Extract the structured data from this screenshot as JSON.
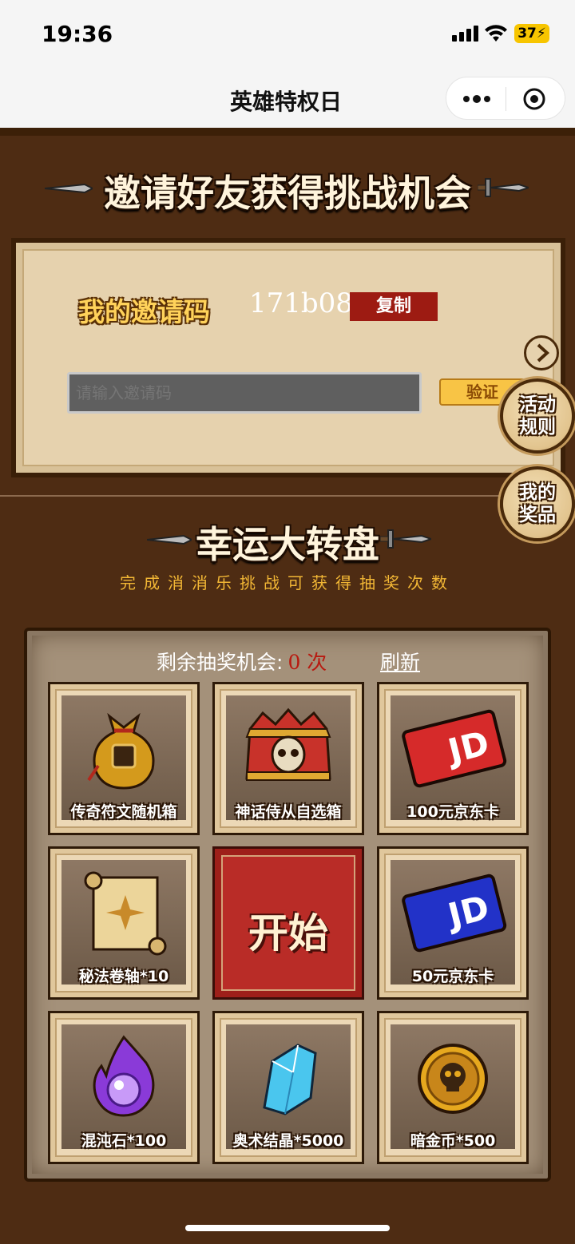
{
  "status_bar": {
    "time": "19:36",
    "battery": "37"
  },
  "navbar": {
    "title": "英雄特权日"
  },
  "invite_section": {
    "heading": "邀请好友获得挑战机会",
    "code_label": "我的邀请码",
    "code_value": "171b08",
    "copy_label": "复制",
    "input_placeholder": "请输入邀请码",
    "verify_label": "验证"
  },
  "side_buttons": {
    "rules": "活动规则",
    "prizes": "我的奖品"
  },
  "lottery": {
    "heading": "幸运大转盘",
    "subtitle": "完成消消乐挑战可获得抽奖次数",
    "remaining_label": "剩余抽奖机会:",
    "remaining_count": "0",
    "remaining_unit": "次",
    "refresh_label": "刷新",
    "start_label": "开始",
    "prizes": [
      {
        "name": "传奇符文随机箱",
        "icon": "treasure-bag-icon"
      },
      {
        "name": "神话侍从自选箱",
        "icon": "skull-chest-icon"
      },
      {
        "name": "100元京东卡",
        "icon": "jd-card-red-icon"
      },
      {
        "name": "秘法卷轴*10",
        "icon": "scroll-icon"
      },
      {
        "name": "50元京东卡",
        "icon": "jd-card-blue-icon"
      },
      {
        "name": "混沌石*100",
        "icon": "chaos-stone-icon"
      },
      {
        "name": "奥术结晶*5000",
        "icon": "crystal-icon"
      },
      {
        "name": "暗金币*500",
        "icon": "skull-coin-icon"
      }
    ],
    "card_text": "JD"
  },
  "colors": {
    "background": "#4e2c13",
    "panel": "#e6d2ae",
    "accent_red": "#b92c27",
    "gold_text": "#f2b735"
  }
}
